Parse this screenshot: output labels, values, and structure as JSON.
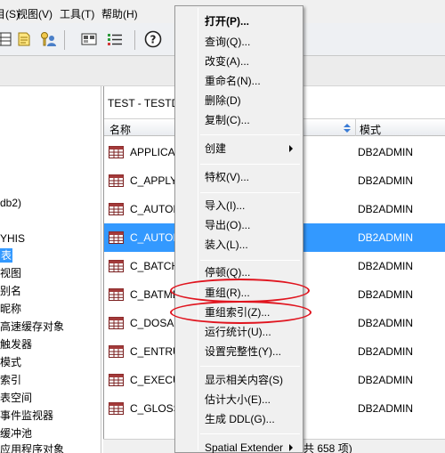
{
  "menubar": {
    "items": [
      {
        "label": "目(S)"
      },
      {
        "label": "视图(V)"
      },
      {
        "label": "工具(T)"
      },
      {
        "label": "帮助(H)"
      }
    ]
  },
  "toolbar": {
    "icons": [
      "table-list-icon",
      "notes-icon",
      "key-user-icon",
      "tile-icon",
      "checklist-icon",
      "help-icon"
    ],
    "help_glyph": "?"
  },
  "tree": {
    "items": [
      {
        "label": "db2)"
      },
      {
        "label": "YHIS"
      },
      {
        "label": "表",
        "selected": true
      },
      {
        "label": "视图"
      },
      {
        "label": "别名"
      },
      {
        "label": "昵称"
      },
      {
        "label": "高速缓存对象"
      },
      {
        "label": "触发器"
      },
      {
        "label": "模式"
      },
      {
        "label": "索引"
      },
      {
        "label": "表空间"
      },
      {
        "label": "事件监视器"
      },
      {
        "label": "缓冲池"
      },
      {
        "label": "应用程序对象"
      }
    ]
  },
  "panel": {
    "title": "TEST - TESTDB",
    "columns": {
      "name": "名称",
      "schema": "模式"
    },
    "rows": [
      {
        "name": "APPLICATION",
        "schema": "DB2ADMIN",
        "selected": false
      },
      {
        "name": "C_APPLY",
        "schema": "DB2ADMIN",
        "selected": false
      },
      {
        "name": "C_AUTOMA",
        "schema": "DB2ADMIN",
        "selected": false
      },
      {
        "name": "C_AUTOM",
        "schema": "DB2ADMIN",
        "selected": true
      },
      {
        "name": "C_BATCH",
        "schema": "DB2ADMIN",
        "selected": false
      },
      {
        "name": "C_BATME",
        "schema": "DB2ADMIN",
        "selected": false
      },
      {
        "name": "C_DOSAGE",
        "schema": "DB2ADMIN",
        "selected": false
      },
      {
        "name": "C_ENTRUS",
        "schema": "DB2ADMIN",
        "selected": false
      },
      {
        "name": "C_EXECUT",
        "schema": "DB2ADMIN",
        "selected": false
      },
      {
        "name": "C_GLOSS",
        "schema": "DB2ADMIN",
        "selected": false
      }
    ],
    "footer": "共 658 项)"
  },
  "context_menu": {
    "items": [
      {
        "label": "打开(P)...",
        "bold": true
      },
      {
        "label": "查询(Q)..."
      },
      {
        "label": "改变(A)..."
      },
      {
        "label": "重命名(N)..."
      },
      {
        "label": "删除(D)"
      },
      {
        "label": "复制(C)..."
      },
      {
        "label": "创建",
        "submenu": true
      },
      {
        "label": "特权(V)..."
      },
      {
        "label": "导入(I)..."
      },
      {
        "label": "导出(O)..."
      },
      {
        "label": "装入(L)..."
      },
      {
        "label": "停顿(Q)..."
      },
      {
        "label": "重组(R)..."
      },
      {
        "label": "重组索引(Z)..."
      },
      {
        "label": "运行统计(U)..."
      },
      {
        "label": "设置完整性(Y)..."
      },
      {
        "label": "显示相关内容(S)"
      },
      {
        "label": "估计大小(E)..."
      },
      {
        "label": "生成 DDL(G)..."
      },
      {
        "label": "Spatial Extender",
        "submenu": true
      }
    ]
  },
  "colors": {
    "selection": "#3399ff",
    "annotation": "#e0141e"
  }
}
